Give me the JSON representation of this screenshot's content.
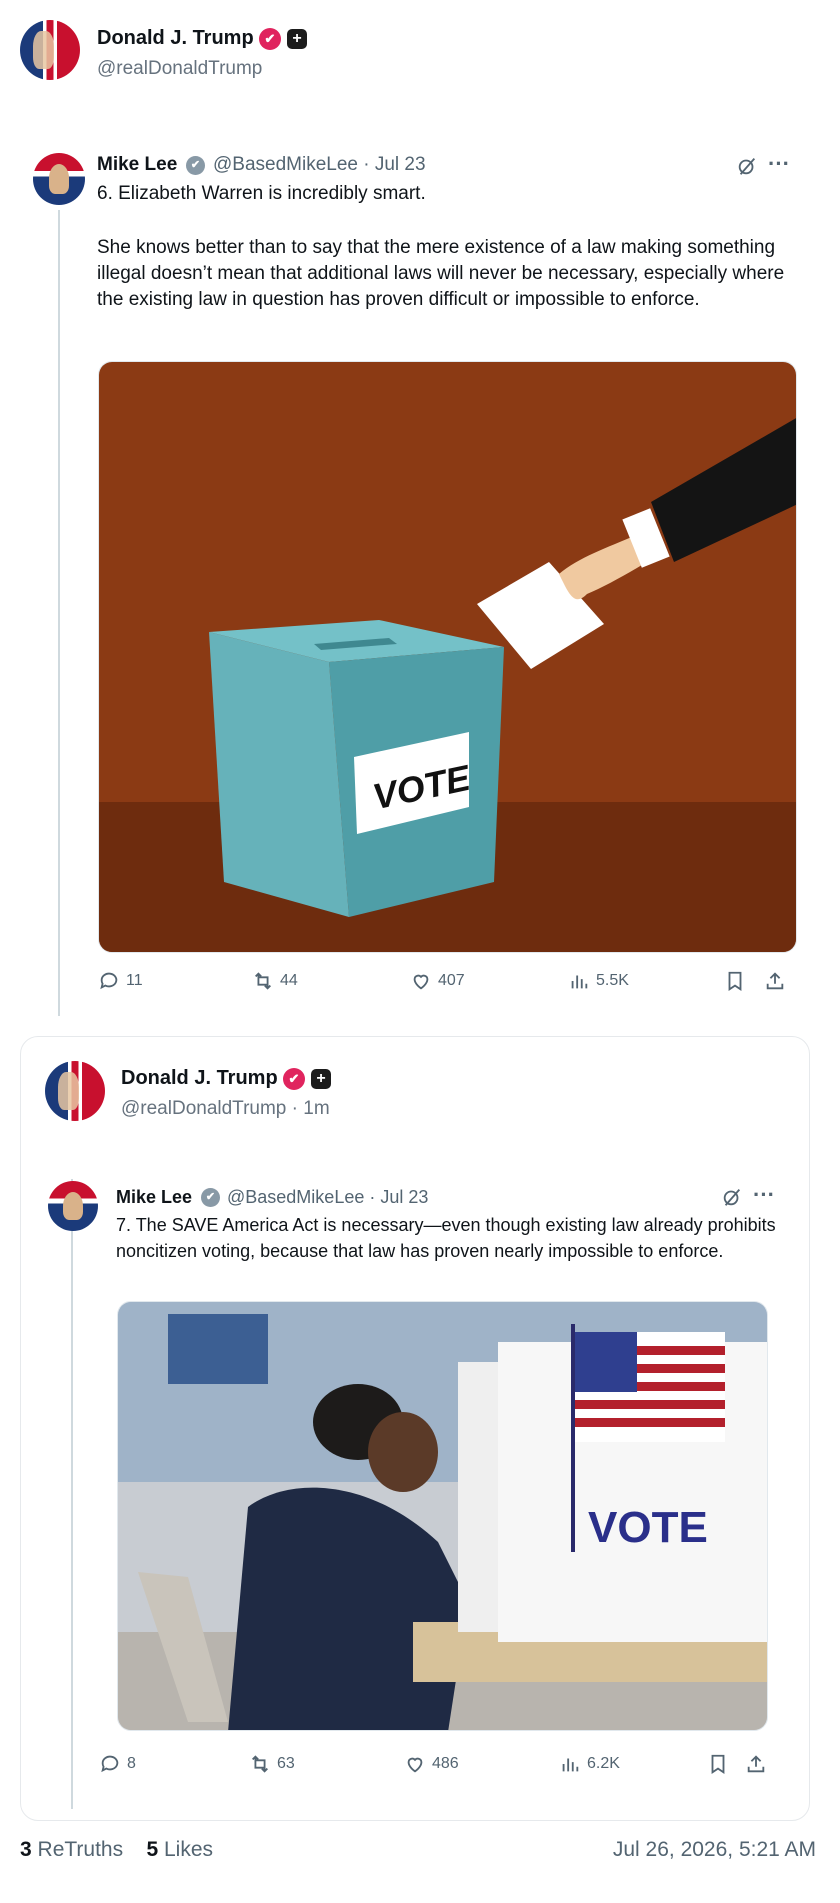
{
  "post": {
    "author_name": "Donald J. Trump",
    "author_handle": "@realDonaldTrump",
    "verified_badge": "✔",
    "plus_badge": "+"
  },
  "quote1": {
    "name": "Mike Lee",
    "meta": "@BasedMikeLee · Jul 23",
    "line1": "6. Elizabeth Warren is incredibly smart.",
    "body": "She knows better than to say that the mere existence of a law making something illegal doesn’t mean that additional laws will never be necessary, especially where the existing law in question has proven difficult or impossible to enforce.",
    "image_text": "VOTE",
    "stats": {
      "replies": "11",
      "reposts": "44",
      "likes": "407",
      "views": "5.5K"
    }
  },
  "card": {
    "author_name": "Donald J. Trump",
    "author_handle": "@realDonaldTrump · 1m",
    "verified_badge": "✔",
    "plus_badge": "+"
  },
  "quote2": {
    "name": "Mike Lee",
    "meta": "@BasedMikeLee · Jul 23",
    "body": "7. The SAVE America Act is necessary—even though existing law already prohibits noncitizen voting, because that law has proven nearly impossible to enforce.",
    "image_text": "VOTE",
    "stats": {
      "replies": "8",
      "reposts": "63",
      "likes": "486",
      "views": "6.2K"
    }
  },
  "footer": {
    "retruths_count": "3",
    "retruths_label": "ReTruths",
    "likes_count": "5",
    "likes_label": "Likes",
    "timestamp": "Jul 26, 2026, 5:21 AM"
  },
  "colors": {
    "verified_pink": "#e0245e",
    "muted_text": "#536471",
    "vote_bg": "#8b3a14",
    "ballot_box": "#5aa7b0"
  },
  "icons": [
    "reply-icon",
    "repost-icon",
    "like-icon",
    "views-icon",
    "bookmark-icon",
    "share-icon",
    "grok-icon",
    "more-icon"
  ]
}
